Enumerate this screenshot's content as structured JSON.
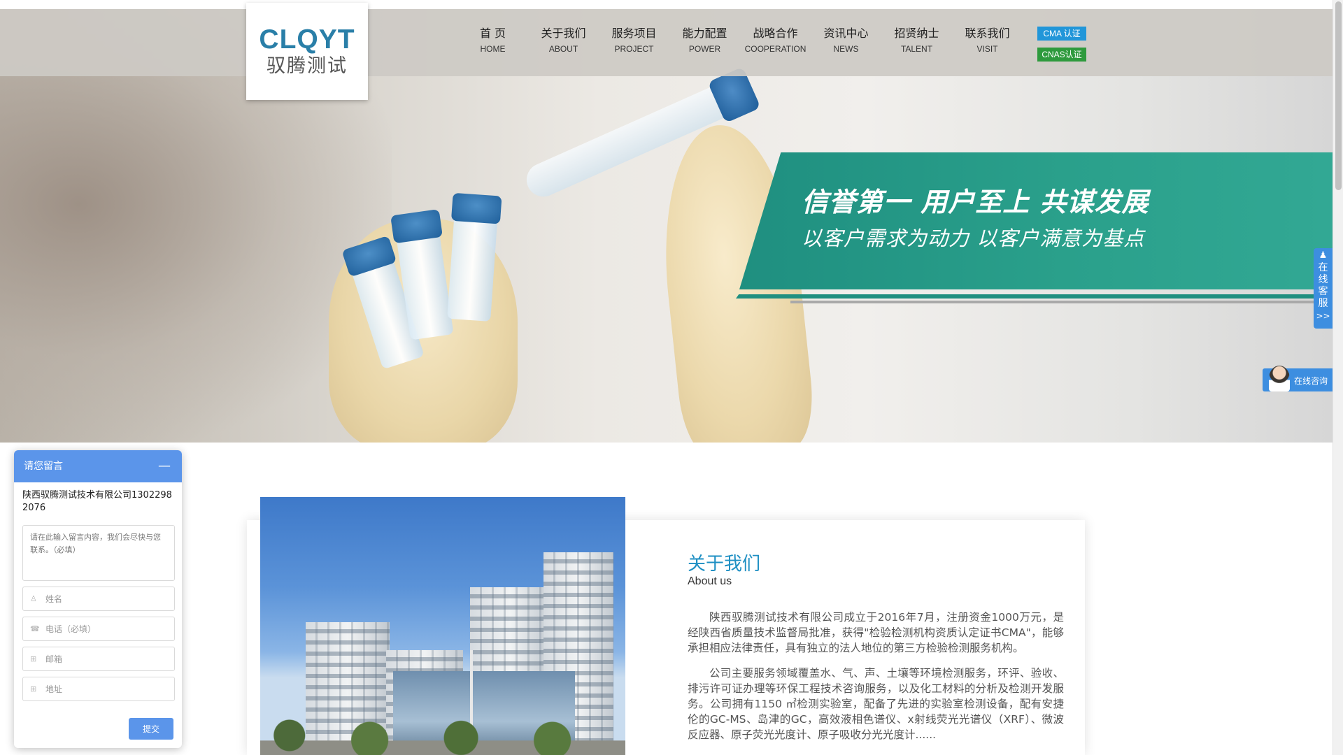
{
  "header": {
    "logo": {
      "en": "CLQYT",
      "cn": "驭腾测试"
    },
    "nav": [
      {
        "cn": "首 页",
        "en": "HOME"
      },
      {
        "cn": "关于我们",
        "en": "ABOUT"
      },
      {
        "cn": "服务项目",
        "en": "PROJECT"
      },
      {
        "cn": "能力配置",
        "en": "POWER"
      },
      {
        "cn": "战略合作",
        "en": "COOPERATION"
      },
      {
        "cn": "资讯中心",
        "en": "NEWS"
      },
      {
        "cn": "招贤纳士",
        "en": "TALENT"
      },
      {
        "cn": "联系我们",
        "en": "VISIT"
      }
    ],
    "certs": {
      "cma": "CMA 认证",
      "cnas": "CNAS认证"
    }
  },
  "hero": {
    "slogan_main": "信誉第一 用户至上 共谋发展",
    "slogan_sub": "以客户需求为动力 以客户满意为基点"
  },
  "float": {
    "kefu_label": "在线客服",
    "kefu_arrow": ">>",
    "consult_label": "在线咨询"
  },
  "about": {
    "title": "关于我们",
    "subtitle": "About us",
    "p1": "陕西驭腾测试技术有限公司成立于2016年7月，注册资金1000万元，是经陕西省质量技术监督局批准，获得\"检验检测机构资质认定证书CMA\"，能够承担相应法律责任，具有独立的法人地位的第三方检验检测服务机构。",
    "p2": "公司主要服务领域覆盖水、气、声、土壤等环境检测服务，环评、验收、排污许可证办理等环保工程技术咨询服务，以及化工材料的分析及检测开发服务。公司拥有1150 ㎡检测实验室，配备了先进的实验室检测设备，配有安捷伦的GC-MS、岛津的GC，高效液相色谱仪、x射线荧光光谱仪（XRF）、微波反应器、原子荧光光度计、原子吸收分光光度计......"
  },
  "message_widget": {
    "title": "请您留言",
    "minimize": "—",
    "company": "陕西驭腾测试技术有限公司13022982076",
    "textarea_placeholder": "请在此输入留言内容，我们会尽快与您联系。（必填）",
    "name_placeholder": "姓名",
    "phone_placeholder": "电话（必填）",
    "email_placeholder": "邮箱",
    "address_placeholder": "地址",
    "submit": "提交"
  },
  "colors": {
    "accent_teal": "#2aa08b",
    "title_blue": "#1e8fc3",
    "widget_blue": "#5b95ea",
    "cma_blue": "#2196d9",
    "cnas_green": "#2e9a3d"
  }
}
